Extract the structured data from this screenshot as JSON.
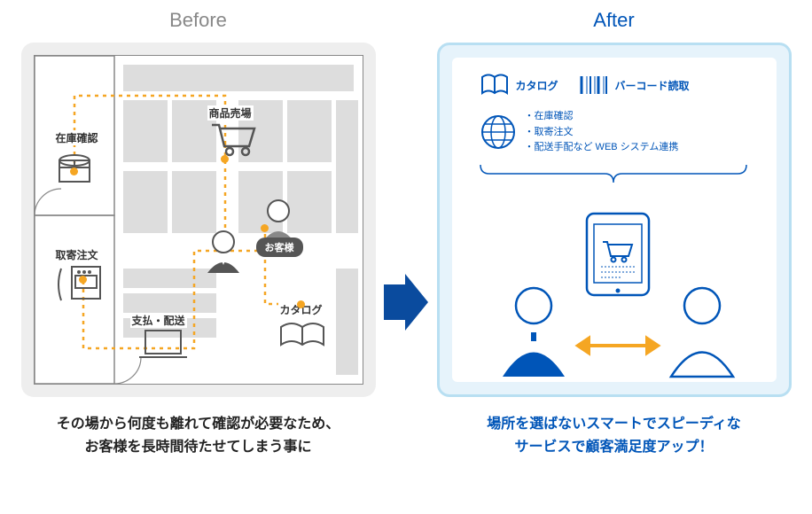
{
  "before": {
    "title": "Before",
    "labels": {
      "stock": "在庫確認",
      "order": "取寄注文",
      "pay": "支払・配送",
      "sales": "商品売場",
      "catalog": "カタログ",
      "customer": "お客様"
    },
    "caption_l1": "その場から何度も離れて確認が必要なため、",
    "caption_l2": "お客様を長時間待たせてしまう事に"
  },
  "after": {
    "title": "After",
    "features": {
      "catalog": "カタログ",
      "barcode": "バーコード読取"
    },
    "bullets": [
      "・在庫確認",
      "・取寄注文",
      "・配送手配など WEB システム連携"
    ],
    "caption_l1": "場所を選ばないスマートでスピーディな",
    "caption_l2": "サービスで顧客満足度アップ！"
  }
}
